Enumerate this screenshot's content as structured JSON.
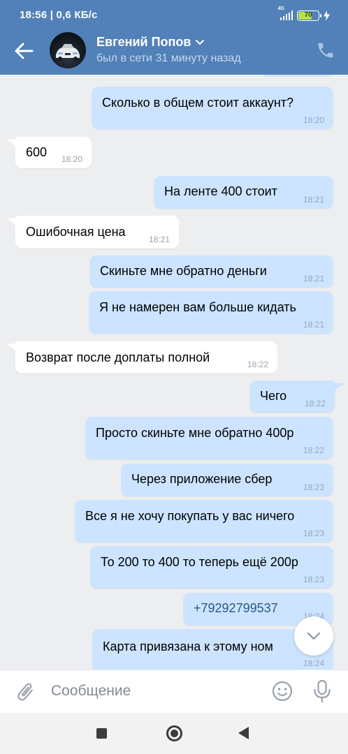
{
  "status_bar": {
    "time": "18:56",
    "speed": "0,6 КБ/с",
    "network": "4G",
    "battery": "70",
    "battery_percent": 70
  },
  "header": {
    "name": "Евгений Попов",
    "status": "был в сети 31 минуту назад"
  },
  "messages": [
    {
      "dir": "out",
      "text": "Сколько в общем стоит аккаунт?",
      "time": "18:20"
    },
    {
      "dir": "in",
      "text": "600",
      "time": "18:20"
    },
    {
      "dir": "out",
      "text": "На ленте 400 стоит",
      "time": "18:21"
    },
    {
      "dir": "in",
      "text": "Ошибочная цена",
      "time": "18:21"
    },
    {
      "dir": "out",
      "text": "Скиньте мне обратно деньги",
      "time": "18:21"
    },
    {
      "dir": "out",
      "text": "Я не намерен вам больше кидать",
      "time": "18:21"
    },
    {
      "dir": "in",
      "text": "Возврат после доплаты полной",
      "time": "18:22"
    },
    {
      "dir": "out",
      "text": "Чего",
      "time": "18:22"
    },
    {
      "dir": "out",
      "text": "Просто скиньте мне обратно 400р",
      "time": "18:22"
    },
    {
      "dir": "out",
      "text": "Через приложение сбер",
      "time": "18:23"
    },
    {
      "dir": "out",
      "text": "Все я не хочу покупать у вас ничего",
      "time": "18:23"
    },
    {
      "dir": "out",
      "text": "То 200 то 400 то теперь ещё 200р",
      "time": "18:23"
    },
    {
      "dir": "out",
      "text": "+79292799537",
      "time": "18:24",
      "link": true
    },
    {
      "dir": "out",
      "text": "Карта привязана к этому ном",
      "time": "18:24"
    }
  ],
  "composer": {
    "placeholder": "Сообщение"
  },
  "colors": {
    "header": "#5181b8",
    "outgoing_bubble": "#cce4ff",
    "incoming_bubble": "#ffffff",
    "background": "#edeef0"
  },
  "icons": [
    "back-arrow-icon",
    "chevron-down-icon",
    "phone-icon",
    "attach-icon",
    "emoji-icon",
    "microphone-icon",
    "chevron-down-icon"
  ]
}
